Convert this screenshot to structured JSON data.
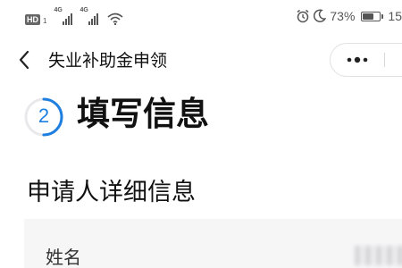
{
  "status_bar": {
    "hd_label": "HD",
    "hd_sub": "1",
    "network_1": "4G",
    "network_2": "4G",
    "battery_text": "73%",
    "battery_level": 0.73,
    "time_partial": "15"
  },
  "nav": {
    "title": "失业补助金申领"
  },
  "step": {
    "number": "2",
    "title": "填写信息"
  },
  "section": {
    "title": "申请人详细信息"
  },
  "form": {
    "name_label": "姓名"
  },
  "colors": {
    "accent": "#1f7fe0",
    "text": "#111111",
    "card_bg": "#f6f6f7"
  }
}
